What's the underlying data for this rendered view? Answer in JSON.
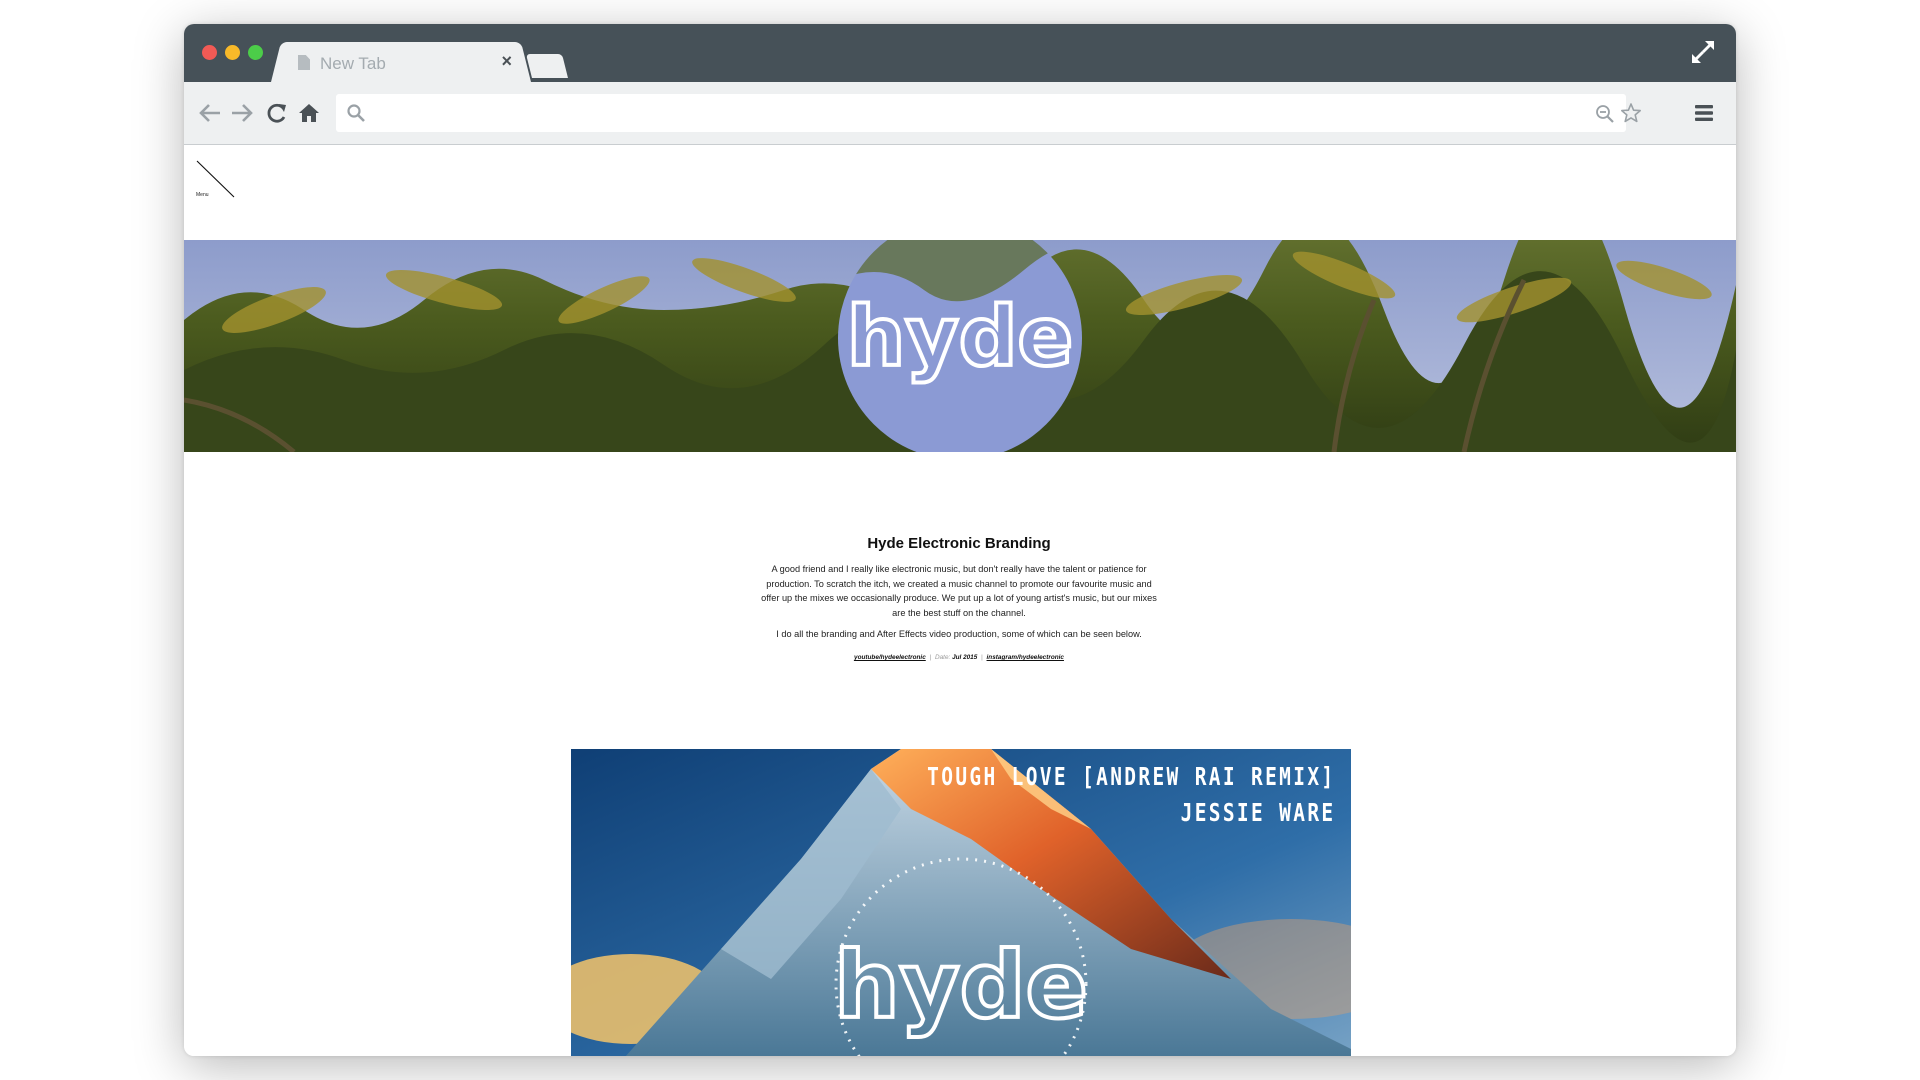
{
  "browser": {
    "tab": {
      "title": "New Tab",
      "close_label": "×"
    },
    "address": {
      "value": "",
      "placeholder": ""
    }
  },
  "site": {
    "menu_label": "Menu",
    "hero_logo_text": "hyde",
    "intro": {
      "title": "Hyde Electronic Branding",
      "paragraph_1": "A good friend and I really like electronic music, but don't really have the talent or patience for production. To scratch the itch, we created a music channel to promote our favourite music and offer up the mixes we occasionally produce. We put up a lot of young artist's music, but our mixes are the best stuff on the channel.",
      "paragraph_2": "I do all the branding and After Effects video production, some of which can be seen below.",
      "meta": {
        "youtube": "youtube/hydeelectronic",
        "date_label": "Date:",
        "date_value": "Jul 2015",
        "instagram": "instagram/hydeelectronic",
        "separator": "|"
      }
    },
    "artwork": {
      "track": "TOUGH LOVE [ANDREW RAI REMIX]",
      "artist": "JESSIE WARE",
      "logo_text": "hyde"
    }
  },
  "colors": {
    "titlebar": "#465158",
    "toolbar": "#eef0f1",
    "close_dot": "#f25a55",
    "minimize_dot": "#f8b929",
    "zoom_dot": "#4ccd49"
  }
}
